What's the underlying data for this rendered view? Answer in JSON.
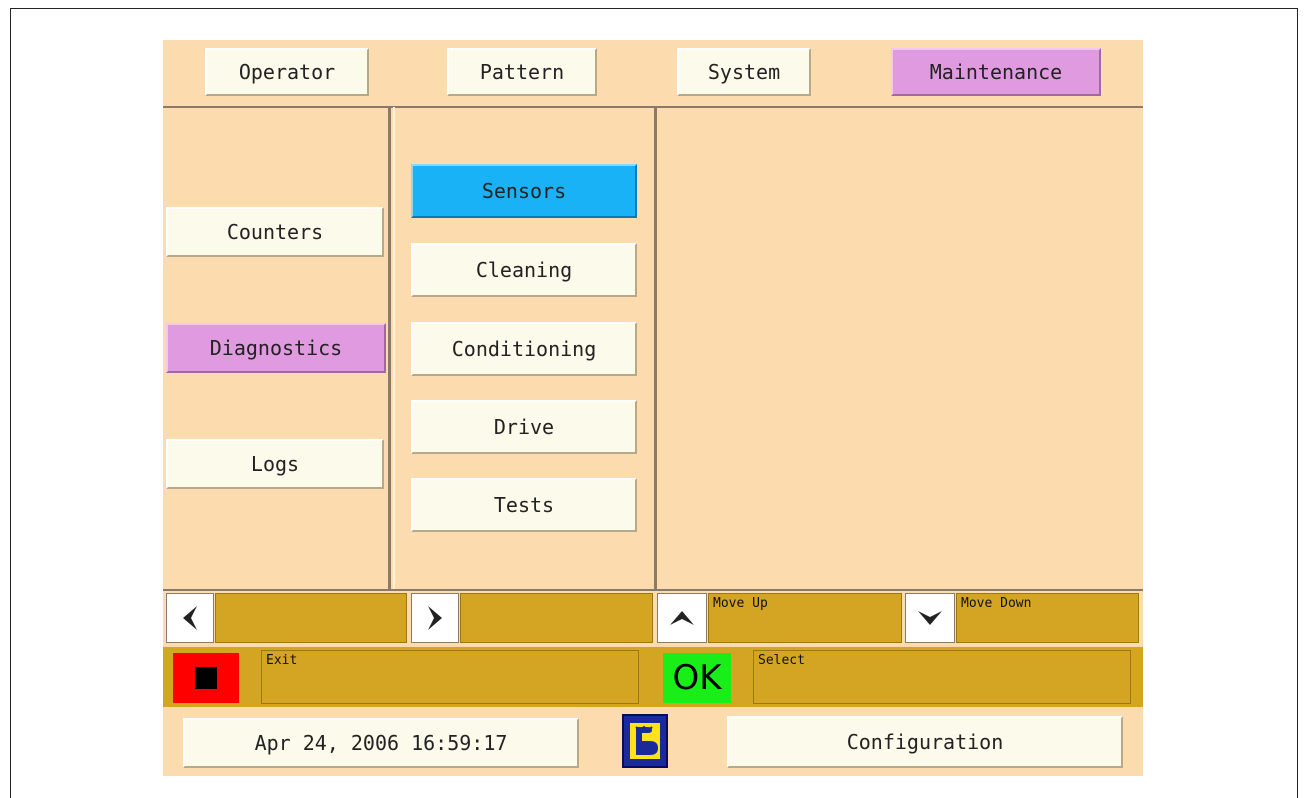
{
  "tabs": [
    {
      "label": "Operator",
      "active": false
    },
    {
      "label": "Pattern",
      "active": false
    },
    {
      "label": "System",
      "active": false
    },
    {
      "label": "Maintenance",
      "active": true
    }
  ],
  "left_menu": [
    {
      "label": "Counters",
      "active": false
    },
    {
      "label": "Diagnostics",
      "active": true
    },
    {
      "label": "Logs",
      "active": false
    }
  ],
  "sub_menu": [
    {
      "label": "Sensors",
      "selected": true
    },
    {
      "label": "Cleaning",
      "selected": false
    },
    {
      "label": "Conditioning",
      "selected": false
    },
    {
      "label": "Drive",
      "selected": false
    },
    {
      "label": "Tests",
      "selected": false
    }
  ],
  "nav": {
    "left_icon": "arrow-left-icon",
    "right_icon": "arrow-right-icon",
    "up_icon": "arrow-up-icon",
    "down_icon": "arrow-down-icon",
    "move_up_label": "Move Up",
    "move_down_label": "Move Down"
  },
  "actions": {
    "exit_icon": "stop-icon",
    "exit_label": "Exit",
    "ok_label": "OK",
    "select_label": "Select"
  },
  "status": {
    "datetime": "Apr 24, 2006 16:59:17",
    "logo_icon": "brand-logo-icon",
    "configuration_label": "Configuration"
  },
  "colors": {
    "panel_bg": "#fcdcae",
    "active_tab": "#e09ae0",
    "selected_item": "#1ab2f7",
    "hint_bar": "#d4a523",
    "stop_button": "#ff0000",
    "ok_button": "#19ee19"
  }
}
